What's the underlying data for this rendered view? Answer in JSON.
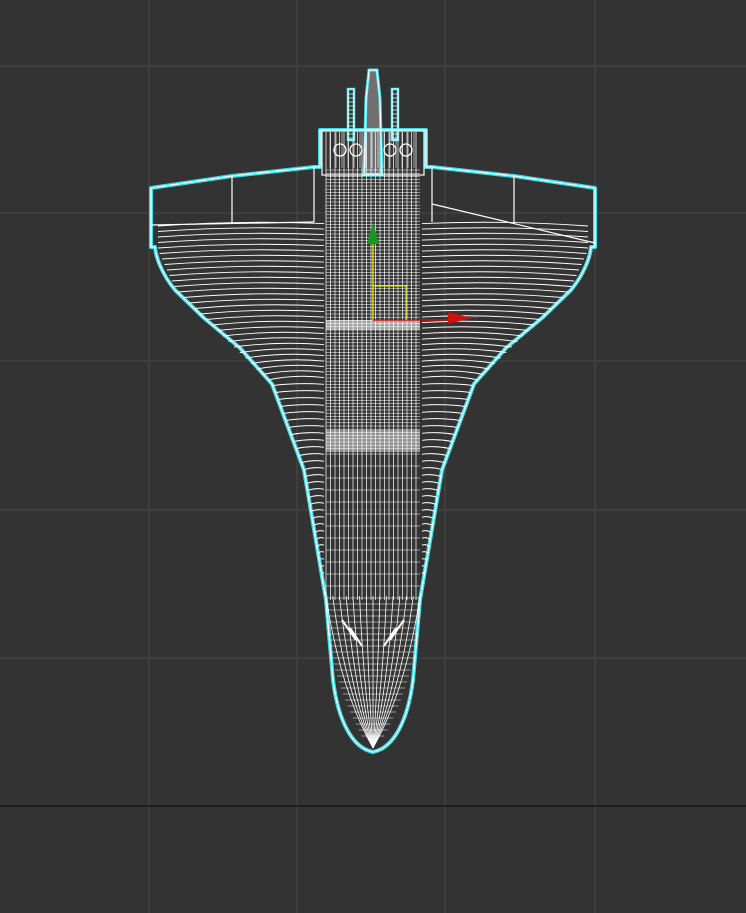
{
  "viewport": {
    "view": "top",
    "background_color": "#333333",
    "grid_color": "#4a4a4a",
    "horizon_line_color": "#111111"
  },
  "model": {
    "render_mode": "wireframe",
    "selected": true,
    "selection_color": "#38dce6",
    "wire_color": "#ffffff"
  },
  "gizmo": {
    "type": "move",
    "x_axis_color": "#cc1111",
    "y_axis_color": "#139a1e",
    "plane_color": "#d9d600"
  }
}
